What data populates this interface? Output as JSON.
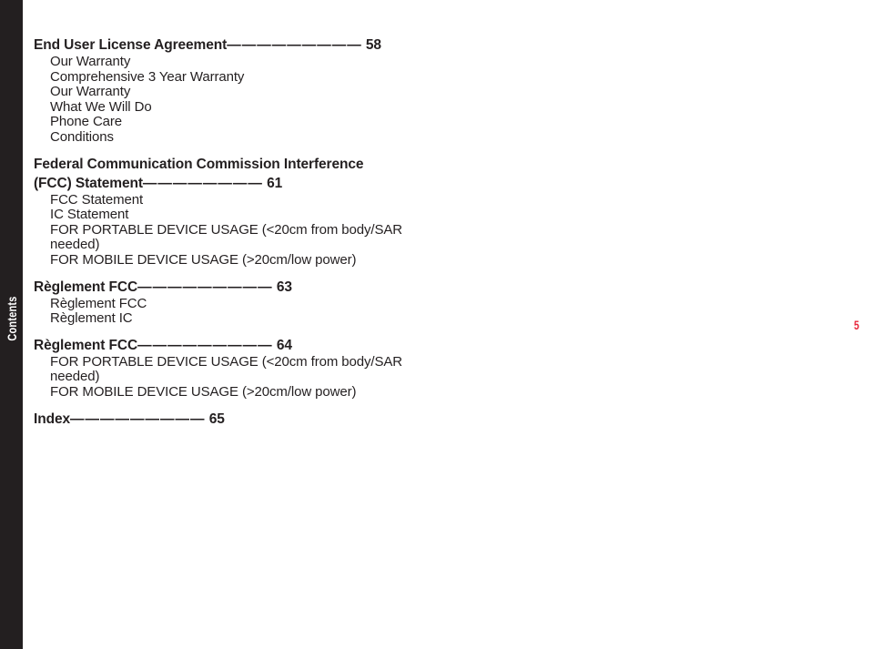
{
  "side_tab": {
    "label": "Contents",
    "background_color": "#231f20",
    "text_color": "#ffffff"
  },
  "page_number": {
    "value": "5",
    "color": "#e8283c"
  },
  "colors": {
    "text": "#231f20",
    "background": "#ffffff",
    "accent": "#e8283c"
  },
  "toc": {
    "leader_dashes": "—————————",
    "leader_dashes_short": "————————",
    "groups": [
      {
        "heading_lines": [
          "End User License Agreement"
        ],
        "leader": "—————————",
        "page": "58",
        "subitems": [
          "Our Warranty",
          "Comprehensive 3 Year Warranty",
          "Our Warranty",
          "What We Will Do",
          "Phone Care",
          "Conditions"
        ]
      },
      {
        "heading_lines": [
          "Federal Communication Commission Interference",
          "(FCC) Statement"
        ],
        "leader": "————————",
        "page": "61",
        "subitems": [
          "FCC Statement",
          "IC Statement",
          "FOR PORTABLE DEVICE USAGE (<20cm from body/SAR needed)",
          "FOR MOBILE DEVICE USAGE (>20cm/low power)"
        ]
      },
      {
        "heading_lines": [
          "Règlement FCC"
        ],
        "leader": "—————————",
        "page": "63",
        "subitems": [
          "Règlement FCC",
          "Règlement IC"
        ]
      },
      {
        "heading_lines": [
          "Règlement FCC"
        ],
        "leader": "—————————",
        "page": "64",
        "subitems": [
          "FOR PORTABLE DEVICE USAGE (<20cm from body/SAR needed)",
          "FOR MOBILE DEVICE USAGE (>20cm/low power)"
        ]
      },
      {
        "heading_lines": [
          "Index"
        ],
        "leader": "—————————",
        "page": "65",
        "subitems": []
      }
    ]
  }
}
